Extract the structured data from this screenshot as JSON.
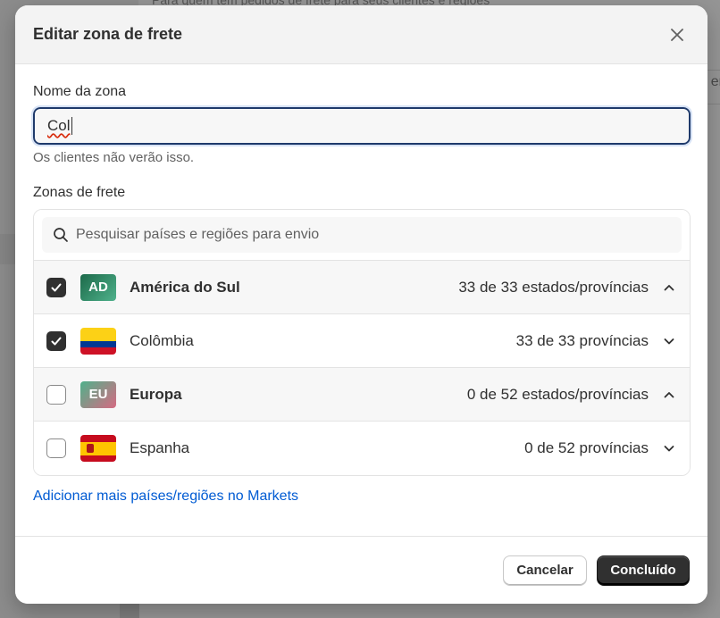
{
  "background": {
    "top_text": "Para quem tem pedidos de frete para seus clientes e regiões",
    "right_text": "er"
  },
  "modal": {
    "title": "Editar zona de frete",
    "zone_name": {
      "label": "Nome da zona",
      "value": "Col",
      "help": "Os clientes não verão isso."
    },
    "zones": {
      "label": "Zonas de frete",
      "search_placeholder": "Pesquisar países e regiões para envio",
      "rows": [
        {
          "type": "group",
          "checked": true,
          "flag_text": "AD",
          "name": "América do Sul",
          "count": "33 de 33 estados/províncias",
          "expanded": true
        },
        {
          "type": "country",
          "checked": true,
          "flag": "colombia",
          "name": "Colômbia",
          "count": "33 de 33 províncias",
          "expanded": false
        },
        {
          "type": "group",
          "checked": false,
          "flag_text": "EU",
          "name": "Europa",
          "count": "0 de 52 estados/províncias",
          "expanded": true
        },
        {
          "type": "country",
          "checked": false,
          "flag": "spain",
          "name": "Espanha",
          "count": "0 de 52 províncias",
          "expanded": false
        }
      ]
    },
    "add_link": "Adicionar mais países/regiões no Markets",
    "footer": {
      "cancel_label": "Cancelar",
      "done_label": "Concluído"
    }
  },
  "colors": {
    "primary_button": "#303030",
    "link": "#005bd3",
    "focus_border": "#1f3a6b"
  }
}
